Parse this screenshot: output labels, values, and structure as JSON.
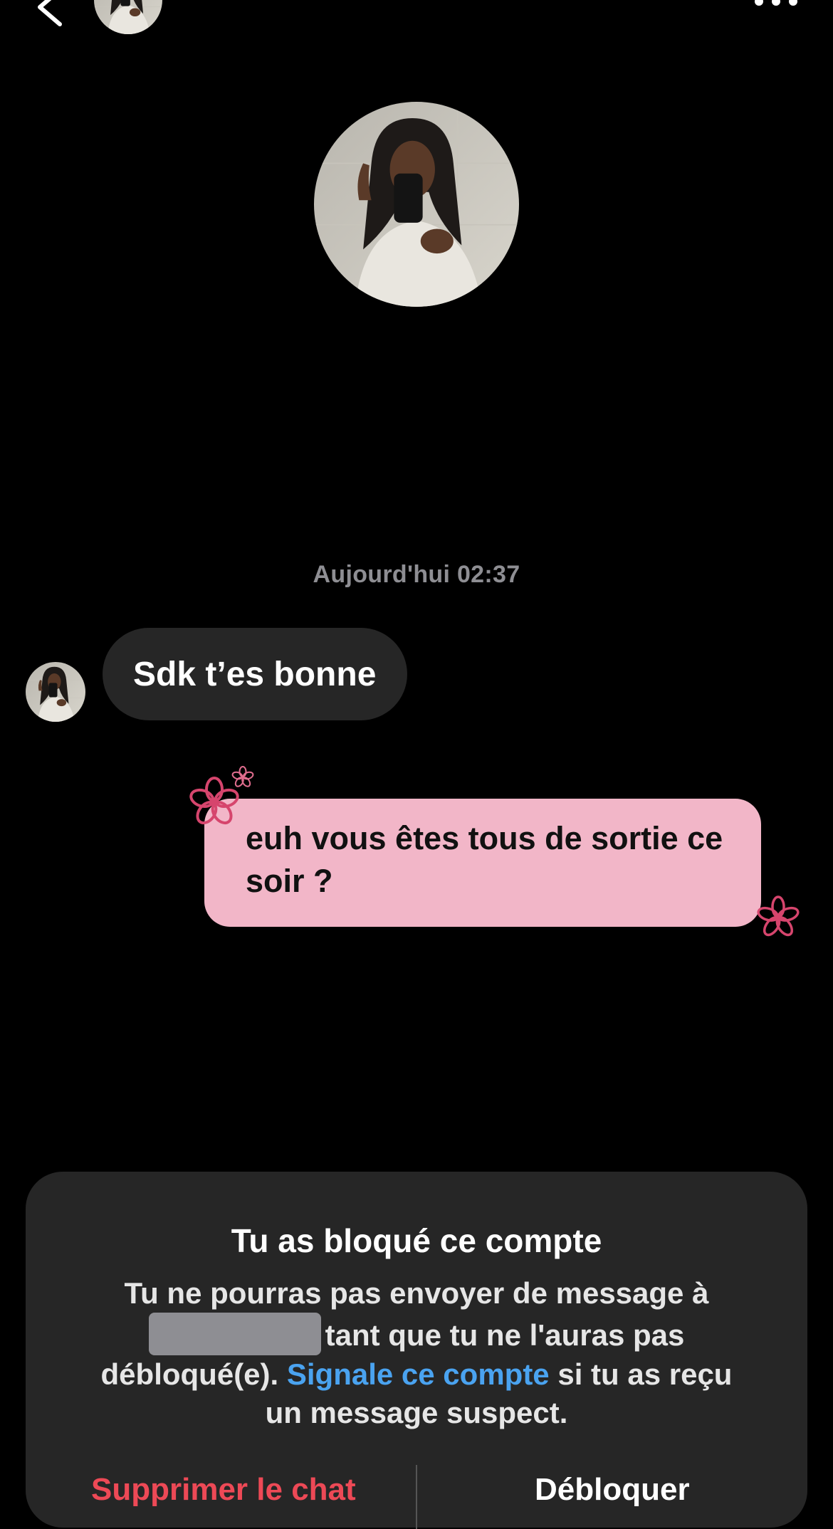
{
  "header": {
    "back_icon": "chevron-left-icon",
    "more_icon": "more-horizontal-icon"
  },
  "conversation": {
    "timestamp": "Aujourd'hui 02:37",
    "messages": [
      {
        "direction": "incoming",
        "text": "Sdk t’es bonne"
      },
      {
        "direction": "outgoing",
        "text": "euh vous êtes tous de sortie ce soir ?"
      }
    ],
    "theme_colors": {
      "incoming_bubble": "#262626",
      "outgoing_bubble": "#f2b6c8",
      "flower_accent": "#d6456d"
    }
  },
  "blocked_notice": {
    "title": "Tu as bloqué ce compte",
    "body_part1": "Tu ne pourras pas envoyer de message à",
    "body_part2": "tant que tu ne l'auras pas débloqué(e).",
    "report_link": "Signale ce compte",
    "body_part3": "si tu as reçu un message suspect.",
    "delete_chat": "Supprimer le chat",
    "unblock": "Débloquer",
    "link_color": "#4aa3f0",
    "danger_color": "#ed4956"
  }
}
